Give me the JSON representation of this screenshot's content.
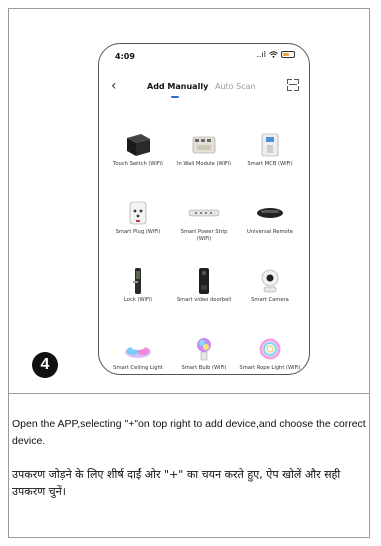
{
  "status_bar": {
    "time": "4:09",
    "signal_text": "..ıl"
  },
  "nav": {
    "back_icon": "chevron-left-icon",
    "active_tab": "Add Manually",
    "inactive_tab": "Auto Scan",
    "scan_icon": "scan-icon"
  },
  "devices": [
    {
      "label": "Touch Switch (WiFi)"
    },
    {
      "label": "In Wall Module (WiFi)"
    },
    {
      "label": "Smart MCB (WiFi)"
    },
    {
      "label": "Smart Plug (WiFi)"
    },
    {
      "label": "Smart Power Strip (WiFi)"
    },
    {
      "label": "Universal Remote"
    },
    {
      "label": "Lock (WiFi)"
    },
    {
      "label": "Smart video doorbell"
    },
    {
      "label": "Smart Camera"
    },
    {
      "label": "Smart Ceiling Light"
    },
    {
      "label": "Smart Bulb (WiFi)"
    },
    {
      "label": "Smart Rope Light (WiFi)"
    }
  ],
  "step_number": "4",
  "instructions": {
    "english": "Open the APP,selecting \"+\"on top right to add device,and choose the correct device.",
    "hindi": "उपकरण जोड़ने के लिए शीर्ष दाईं ओर \"+\" का चयन करते हुए, ऐप खोलें और सही उपकरण चुनें।"
  },
  "colors": {
    "accent": "#2b6be6",
    "battery": "#f2a23a"
  }
}
